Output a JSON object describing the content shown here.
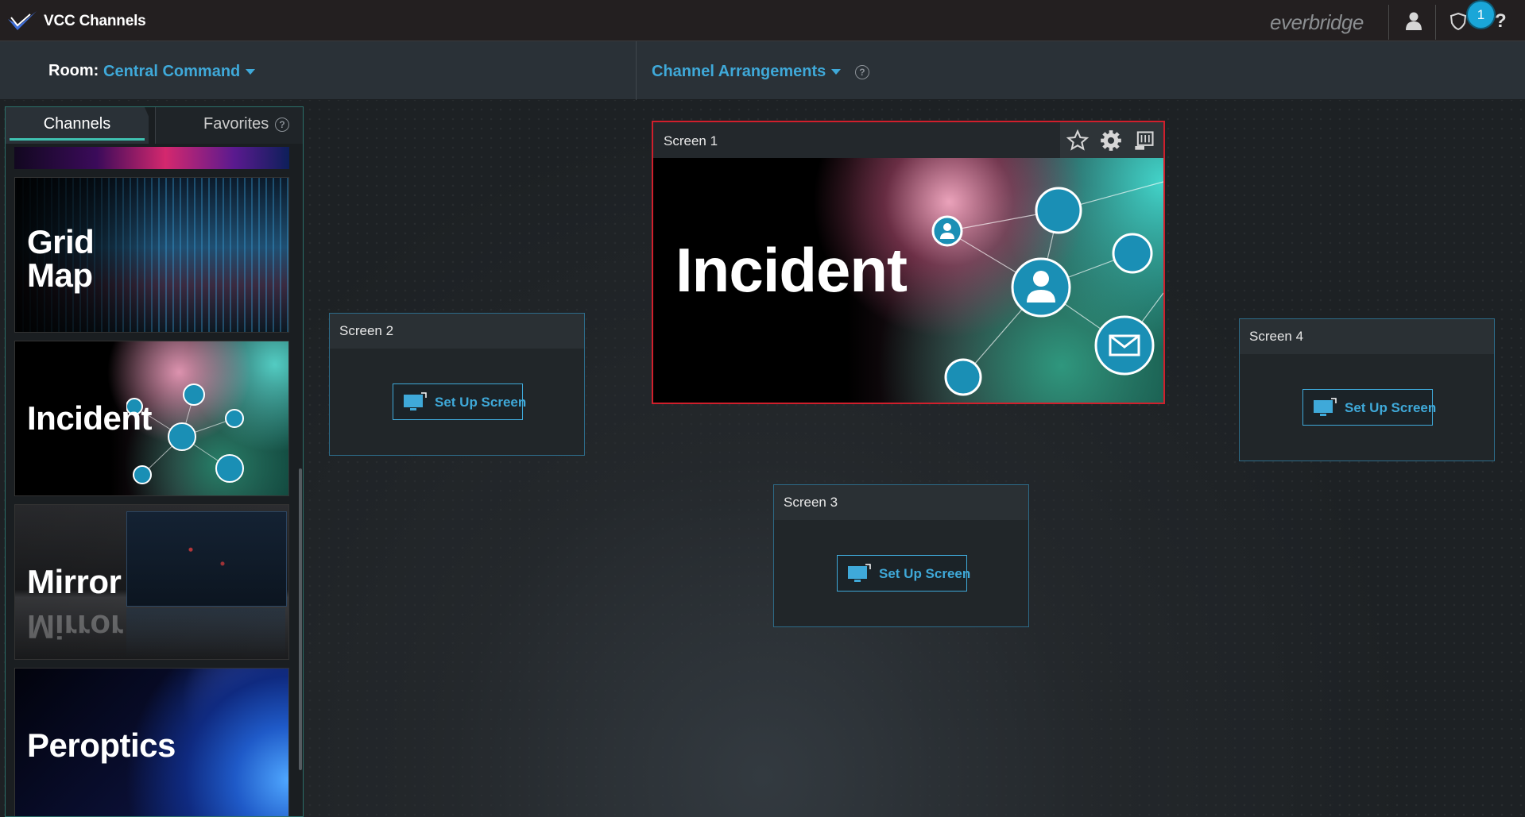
{
  "app": {
    "title": "VCC Channels",
    "brand": "everbridge",
    "notification_count": "1",
    "help": "?"
  },
  "room": {
    "label": "Room:",
    "value": "Central Command"
  },
  "arrangements": {
    "label": "Channel Arrangements"
  },
  "tabs": {
    "channels": "Channels",
    "favorites": "Favorites",
    "help": "?"
  },
  "channels": [
    {
      "title_line1": "Grid",
      "title_line2": "Map"
    },
    {
      "title_line1": "Incident"
    },
    {
      "title_line1": "Mirror"
    },
    {
      "title_line1": "Peroptics"
    }
  ],
  "screens": {
    "screen1": {
      "name": "Screen 1",
      "channel": "Incident"
    },
    "screen2": {
      "name": "Screen 2",
      "button": "Set Up Screen"
    },
    "screen3": {
      "name": "Screen 3",
      "button": "Set Up Screen"
    },
    "screen4": {
      "name": "Screen 4",
      "button": "Set Up Screen"
    }
  },
  "colors": {
    "accent": "#3fa9d9",
    "selected_border": "#d01f2c",
    "tab_underline": "#3fc1b0",
    "badge": "#1aa6d8"
  },
  "icons": [
    "logo-icon",
    "user-icon",
    "shield-icon",
    "help-icon",
    "caret-down-icon",
    "question-circle-icon",
    "star-icon",
    "gear-icon",
    "clear-screen-icon",
    "monitor-icon"
  ]
}
